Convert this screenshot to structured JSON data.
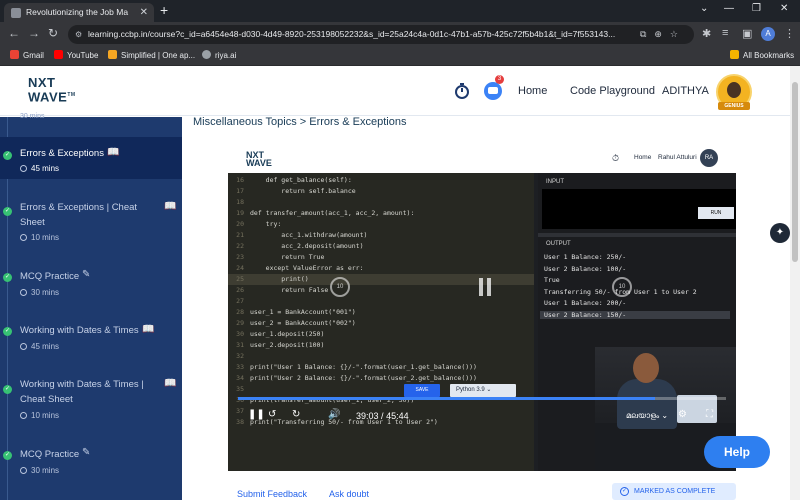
{
  "browser": {
    "tab_title": "Revolutionizing the Job Ma",
    "url": "learning.ccbp.in/course?c_id=a6454e48-d030-4d49-8920-253198052232&s_id=25a24c4a-0d1c-47b1-a57b-425c72f5b4b1&t_id=7f553143...",
    "profile_initial": "A",
    "bookmarks": [
      {
        "label": "Gmail",
        "color": "#ea4335"
      },
      {
        "label": "YouTube",
        "color": "#ff0000"
      },
      {
        "label": "Simplified | One ap...",
        "color": "#f5a623"
      },
      {
        "label": "riya.ai",
        "color": "#9aa0a6"
      }
    ],
    "all_bookmarks": "All Bookmarks"
  },
  "header": {
    "logo_line1": "NXT",
    "logo_line2": "WAVE",
    "logo_tm": "TM",
    "notification_count": "3",
    "nav": [
      "Home",
      "Code Playground"
    ],
    "user_name": "ADITHYA",
    "avatar_badge": "GENIUS"
  },
  "sidebar": {
    "items": [
      {
        "title": "Errors & Exceptions",
        "duration": "45 mins",
        "type": "reading",
        "active": true
      },
      {
        "title": "Errors & Exceptions | Cheat Sheet",
        "duration": "10 mins",
        "type": "reading",
        "active": false
      },
      {
        "title": "MCQ Practice",
        "duration": "30 mins",
        "type": "practice",
        "active": false
      },
      {
        "title": "Working with Dates & Times",
        "duration": "45 mins",
        "type": "reading",
        "active": false
      },
      {
        "title": "Working with Dates & Times | Cheat Sheet",
        "duration": "10 mins",
        "type": "reading",
        "active": false
      },
      {
        "title": "MCQ Practice",
        "duration": "30 mins",
        "type": "practice",
        "active": false
      }
    ],
    "partial_top_duration": "30 mins"
  },
  "content": {
    "breadcrumb": "Miscellaneous Topics > Errors & Exceptions",
    "video": {
      "inner_logo1": "NXT",
      "inner_logo2": "WAVE",
      "inner_home": "Home",
      "inner_user": "Rahul Attuluri",
      "inner_initials": "RA",
      "code_lines": [
        {
          "n": "16",
          "t": "    def get_balance(self):"
        },
        {
          "n": "17",
          "t": "        return self.balance"
        },
        {
          "n": "18",
          "t": ""
        },
        {
          "n": "19",
          "t": "def transfer_amount(acc_1, acc_2, amount):"
        },
        {
          "n": "20",
          "t": "    try:"
        },
        {
          "n": "21",
          "t": "        acc_1.withdraw(amount)"
        },
        {
          "n": "22",
          "t": "        acc_2.deposit(amount)"
        },
        {
          "n": "23",
          "t": "        return True"
        },
        {
          "n": "24",
          "t": "    except ValueError as err:"
        },
        {
          "n": "25",
          "t": "        print()"
        },
        {
          "n": "26",
          "t": "        return False"
        },
        {
          "n": "27",
          "t": ""
        },
        {
          "n": "28",
          "t": "user_1 = BankAccount(\"001\")"
        },
        {
          "n": "29",
          "t": "user_2 = BankAccount(\"002\")"
        },
        {
          "n": "30",
          "t": "user_1.deposit(250)"
        },
        {
          "n": "31",
          "t": "user_2.deposit(100)"
        },
        {
          "n": "32",
          "t": ""
        },
        {
          "n": "33",
          "t": "print(\"User 1 Balance: {}/-\".format(user_1.get_balance()))"
        },
        {
          "n": "34",
          "t": "print(\"User 2 Balance: {}/-\".format(user_2.get_balance()))"
        },
        {
          "n": "35",
          "t": ""
        },
        {
          "n": "36",
          "t": "print(transfer_amount(user_1, user_2, 50))"
        },
        {
          "n": "37",
          "t": ""
        },
        {
          "n": "38",
          "t": "print(\"Transferring 50/- from User 1 to User 2\")"
        }
      ],
      "save_label": "SAVE",
      "language": "Python 3.9",
      "input_label": "INPUT",
      "run_label": "RUN",
      "output_label": "OUTPUT",
      "output_lines": [
        "User 1 Balance: 250/-",
        "User 2 Balance: 100/-",
        "True",
        "Transferring 50/- from User 1 to User 2",
        "User 1 Balance: 200/-",
        "User 2 Balance: 150/-"
      ],
      "skip_seconds": "10",
      "current_time": "39:03",
      "time_separator": "/",
      "total_time": "45:44",
      "progress_fraction": 0.854,
      "caption_language": "മലയാളം"
    },
    "submit_feedback": "Submit Feedback",
    "ask_doubt": "Ask doubt",
    "marked_complete": "MARKED AS COMPLETE"
  },
  "help_label": "Help"
}
